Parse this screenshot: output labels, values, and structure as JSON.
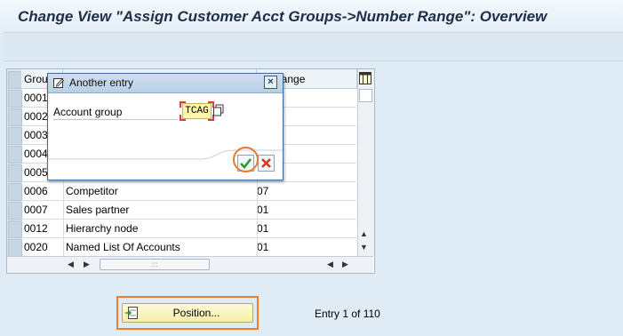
{
  "title": "Change View \"Assign Customer Acct Groups->Number Range\": Overview",
  "table": {
    "columns": [
      "Grou",
      "",
      "ber range"
    ],
    "rows": [
      {
        "group": "0001",
        "name": "",
        "range": ""
      },
      {
        "group": "0002",
        "name": "",
        "range": ""
      },
      {
        "group": "0003",
        "name": "",
        "range": ""
      },
      {
        "group": "0004",
        "name": "",
        "range": ""
      },
      {
        "group": "0005",
        "name": "",
        "range": ""
      },
      {
        "group": "0006",
        "name": "Competitor",
        "range": "07"
      },
      {
        "group": "0007",
        "name": "Sales partner",
        "range": "01"
      },
      {
        "group": "0012",
        "name": "Hierarchy node",
        "range": "01"
      },
      {
        "group": "0020",
        "name": "Named List Of Accounts",
        "range": "01"
      }
    ],
    "hscroll_grip": ":::"
  },
  "dialog": {
    "title": "Another entry",
    "field_label": "Account group",
    "field_value": "TCAG",
    "close_glyph": "×"
  },
  "footer": {
    "position_label": "Position...",
    "entry_text": "Entry 1 of 110"
  },
  "colors": {
    "highlight": "#ed7d31",
    "required_marker": "#e1383a",
    "ok_green": "#2e9a2e",
    "cancel_red": "#d23b1f"
  }
}
